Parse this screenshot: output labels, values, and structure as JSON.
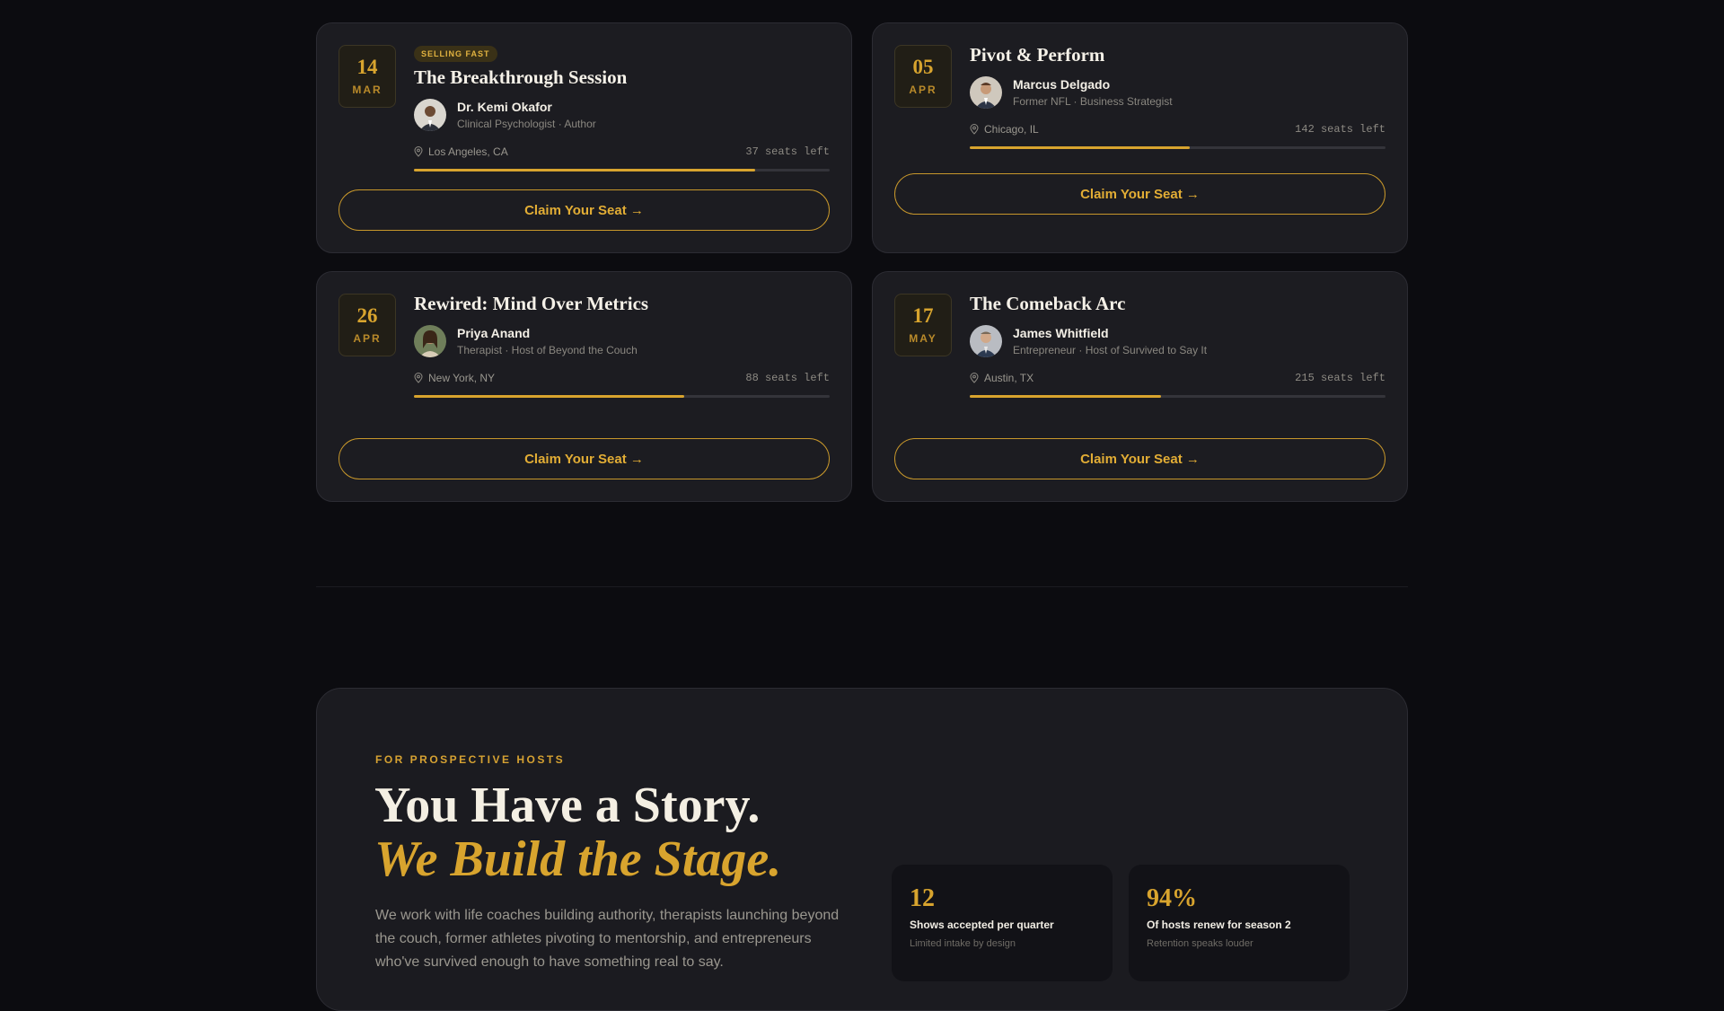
{
  "events": [
    {
      "day": "14",
      "month": "MAR",
      "badge": "SELLING FAST",
      "title": "The Breakthrough Session",
      "host_name": "Dr. Kemi Okafor",
      "host_role": "Clinical Psychologist · Author",
      "location": "Los Angeles, CA",
      "seats": "37 seats left",
      "progress": 0.82,
      "cta": "Claim Your Seat →"
    },
    {
      "day": "05",
      "month": "APR",
      "badge": "",
      "title": "Pivot & Perform",
      "host_name": "Marcus Delgado",
      "host_role": "Former NFL · Business Strategist",
      "location": "Chicago, IL",
      "seats": "142 seats left",
      "progress": 0.53,
      "cta": "Claim Your Seat →"
    },
    {
      "day": "26",
      "month": "APR",
      "badge": "",
      "title": "Rewired: Mind Over Metrics",
      "host_name": "Priya Anand",
      "host_role": "Therapist · Host of Beyond the Couch",
      "location": "New York, NY",
      "seats": "88 seats left",
      "progress": 0.65,
      "cta": "Claim Your Seat →"
    },
    {
      "day": "17",
      "month": "MAY",
      "badge": "",
      "title": "The Comeback Arc",
      "host_name": "James Whitfield",
      "host_role": "Entrepreneur · Host of Survived to Say It",
      "location": "Austin, TX",
      "seats": "215 seats left",
      "progress": 0.46,
      "cta": "Claim Your Seat →"
    }
  ],
  "hosts_section": {
    "eyebrow": "FOR PROSPECTIVE HOSTS",
    "headline_1": "You Have a Story.",
    "headline_2": "We Build the Stage.",
    "lead": "We work with life coaches building authority, therapists launching beyond the couch, former athletes pivoting to mentorship, and entrepreneurs who've survived enough to have something real to say.",
    "stats": [
      {
        "num": "12",
        "label": "Shows accepted per quarter",
        "sub": "Limited intake by design"
      },
      {
        "num": "94%",
        "label": "Of hosts renew for season 2",
        "sub": "Retention speaks louder"
      }
    ]
  },
  "colors": {
    "accent": "#d8a42e",
    "background": "#0c0c10",
    "card": "#1c1c21"
  },
  "icons": {
    "location": "map-pin-icon"
  }
}
